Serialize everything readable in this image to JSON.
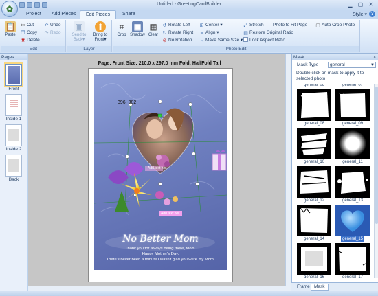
{
  "window": {
    "title": "Untitled - GreetingCardBuilder"
  },
  "tabs": [
    {
      "label": "Project"
    },
    {
      "label": "Add Pieces"
    },
    {
      "label": "Edit Pieces"
    },
    {
      "label": "Share"
    }
  ],
  "style_menu": "Style ▾",
  "ribbon": {
    "edit": {
      "label": "Edit",
      "paste": "Paste",
      "cut": "Cut",
      "copy": "Copy",
      "delete": "Delete",
      "undo": "Undo",
      "redo": "Redo"
    },
    "layer": {
      "label": "Layer",
      "send_to_back": "Send to Back▾",
      "bring_to_front": "Bring to Front▾"
    },
    "photo_edit": {
      "label": "Photo Edit",
      "crop": "Crop",
      "shadow": "Shadow",
      "clear": "Clear",
      "rotate_left": "Rotate Left",
      "rotate_right": "Rotate Right",
      "no_rotation": "No Rotation",
      "center": "Center ▾",
      "align": "Align ▾",
      "make_same_size": "Make Same Size ▾",
      "stretch": "Stretch",
      "photo_to_fit_page": "Photo to Fit Page",
      "auto_crop_photo": "Auto Crop Photo",
      "restore_original_ratio": "Restore Original Ratio",
      "lock_aspect_ratio": "Lock Aspect Ratio"
    }
  },
  "pages_panel": {
    "title": "Pages",
    "pages": [
      {
        "label": "Front"
      },
      {
        "label": "Inside 1"
      },
      {
        "label": "Inside 2"
      },
      {
        "label": "Back"
      }
    ]
  },
  "workspace": {
    "page_info": "Page: Front  Size: 210.0 x 297.0 mm  Fold: HalfFold Tall",
    "coord_readout": "396, 382"
  },
  "card": {
    "add_text_1": "Add text her",
    "add_text_2": "Add text her",
    "headline": "No Better Mom",
    "line1": "Thank you for always being there, Mom.",
    "line2": "Happy Mother's Day.",
    "line3": "There's never been a minute I wasn't glad you were my Mom."
  },
  "mask_panel": {
    "title": "Mask",
    "close": "×",
    "type_label": "Mask Type",
    "type_value": "general",
    "hint": "Double click on mask to apply it to selected photo",
    "masks": [
      {
        "name": "general_06"
      },
      {
        "name": "general_07"
      },
      {
        "name": "general_08"
      },
      {
        "name": "general_09"
      },
      {
        "name": "general_10"
      },
      {
        "name": "general_11"
      },
      {
        "name": "general_12"
      },
      {
        "name": "general_13"
      },
      {
        "name": "general_14"
      },
      {
        "name": "general_15"
      },
      {
        "name": "general_16"
      },
      {
        "name": "general_17"
      }
    ],
    "selected_mask": "general_15"
  },
  "bottom_tabs": [
    {
      "label": "Frame"
    },
    {
      "label": "Mask"
    }
  ],
  "colors": {
    "accent": "#3a6fc8",
    "ribbon_bg": "#dbe8f8",
    "card_bg": "#6f80c0"
  }
}
